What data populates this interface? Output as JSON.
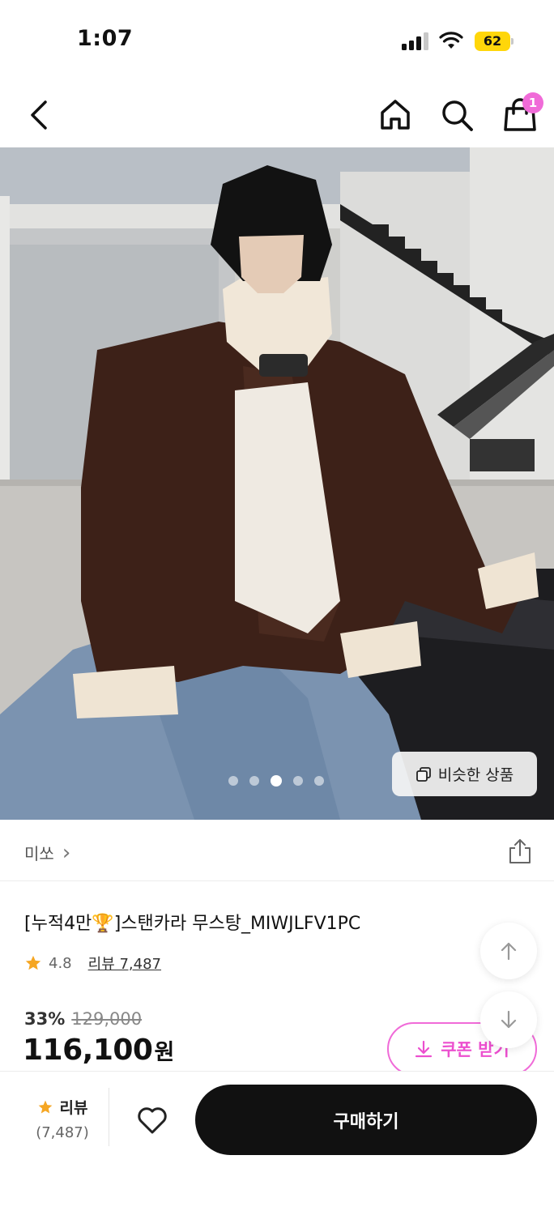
{
  "status_bar": {
    "time": "1:07",
    "battery": "62",
    "battery_color": "#ffd60a"
  },
  "nav": {
    "back_icon": "chevron-left-icon",
    "home_icon": "home-icon",
    "search_icon": "search-icon",
    "cart_icon": "shopping-bag-icon",
    "cart_badge": "1",
    "badge_color": "#f06bd8"
  },
  "gallery": {
    "image_count": 5,
    "active_index": 2,
    "similar_label": "비슷한 상품"
  },
  "brand": {
    "name": "미쏘",
    "chevron": "›"
  },
  "product": {
    "title": "[누적4만🏆]스탠카라 무스탕_MIWJLFV1PC",
    "rating": "4.8",
    "review_label": "리뷰 7,487",
    "discount": "33%",
    "original_price": "129,000",
    "price": "116,100",
    "currency": "원"
  },
  "coupon": {
    "label": "쿠폰 받기",
    "color": "#ec4fcf"
  },
  "bottom_bar": {
    "review_label": "리뷰",
    "review_count": "(7,487)",
    "buy_label": "구매하기"
  }
}
